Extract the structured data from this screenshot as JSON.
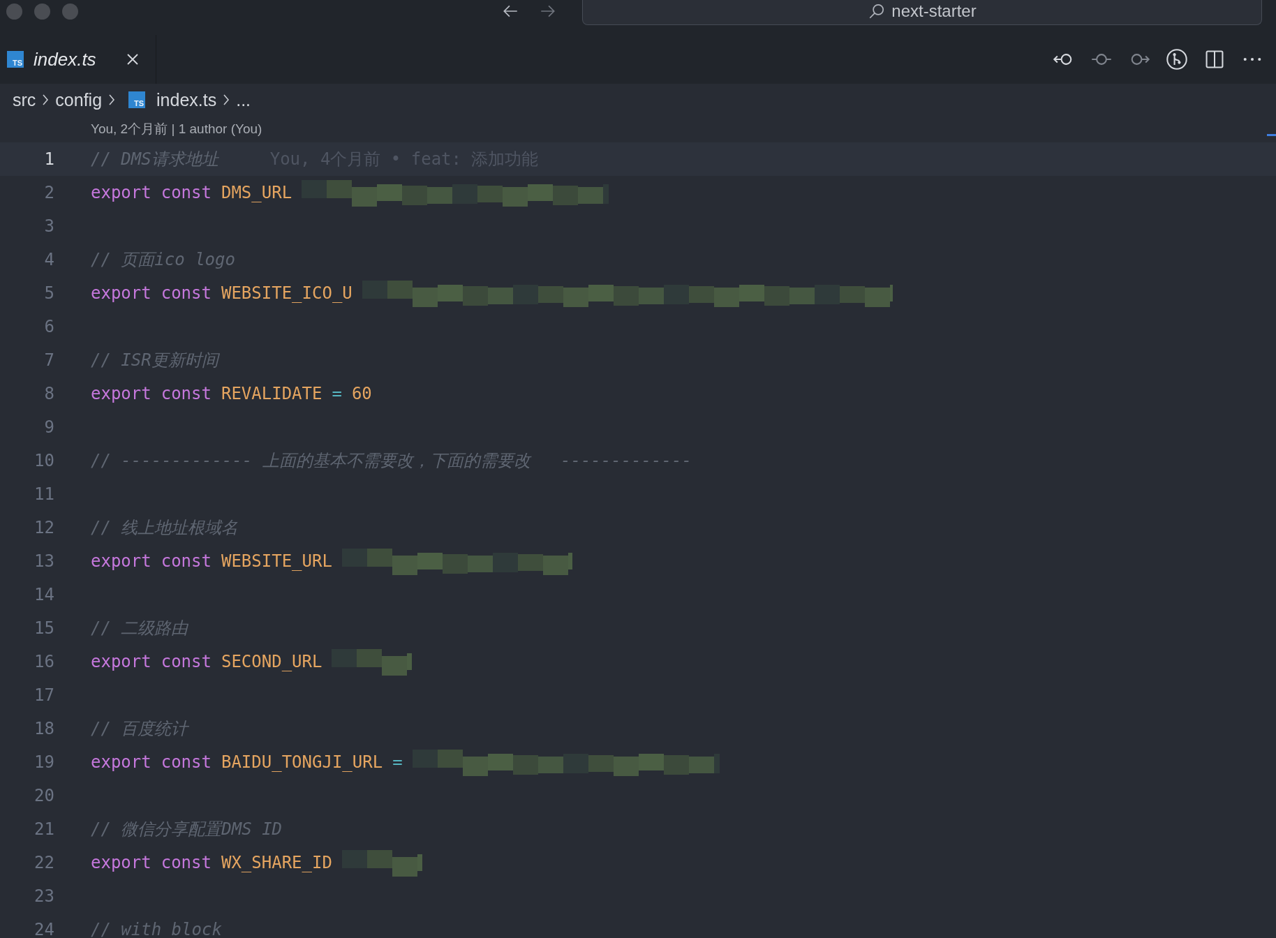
{
  "title_bar": {
    "search_label": "next-starter"
  },
  "tab": {
    "title": "index.ts",
    "file_badge": "TS",
    "selected": true,
    "preview": true
  },
  "breadcrumbs": [
    {
      "label": "src"
    },
    {
      "label": "config"
    },
    {
      "label": "index.ts",
      "file_badge": "TS"
    },
    {
      "label": "..."
    }
  ],
  "blame_header": "You, 2个月前 | 1 author (You)",
  "lines": [
    {
      "number": "1",
      "current": true,
      "tokens": [
        {
          "kind": "comment",
          "text": "// DMS请求地址"
        }
      ],
      "blame": "You, 4个月前 • feat: 添加功能"
    },
    {
      "number": "2",
      "current": false,
      "tokens": [
        {
          "kind": "keyword",
          "text": "export"
        },
        {
          "kind": "keyword",
          "text": "const"
        },
        {
          "kind": "constant",
          "text": "DMS_URL"
        }
      ],
      "redacted": true
    },
    {
      "number": "3",
      "current": false
    },
    {
      "number": "4",
      "current": false,
      "tokens": [
        {
          "kind": "comment",
          "text": "// 页面ico logo"
        }
      ]
    },
    {
      "number": "5",
      "current": false,
      "tokens": [
        {
          "kind": "keyword",
          "text": "export"
        },
        {
          "kind": "keyword",
          "text": "const"
        },
        {
          "kind": "constant",
          "text": "WEBSITE_ICO_U"
        }
      ],
      "redacted": true
    },
    {
      "number": "6",
      "current": false
    },
    {
      "number": "7",
      "current": false,
      "tokens": [
        {
          "kind": "comment",
          "text": "// ISR更新时间"
        }
      ]
    },
    {
      "number": "8",
      "current": false,
      "tokens": [
        {
          "kind": "keyword",
          "text": "export"
        },
        {
          "kind": "keyword",
          "text": "const"
        },
        {
          "kind": "constant",
          "text": "REVALIDATE"
        },
        {
          "kind": "operator",
          "text": "="
        },
        {
          "kind": "number",
          "text": "60"
        }
      ]
    },
    {
      "number": "9",
      "current": false
    },
    {
      "number": "10",
      "current": false,
      "tokens": [
        {
          "kind": "comment",
          "text": "// ------------- 上面的基本不需要改，下面的需要改   -------------"
        }
      ]
    },
    {
      "number": "11",
      "current": false
    },
    {
      "number": "12",
      "current": false,
      "tokens": [
        {
          "kind": "comment",
          "text": "// 线上地址根域名"
        }
      ]
    },
    {
      "number": "13",
      "current": false,
      "tokens": [
        {
          "kind": "keyword",
          "text": "export"
        },
        {
          "kind": "keyword",
          "text": "const"
        },
        {
          "kind": "constant",
          "text": "WEBSITE_URL"
        }
      ],
      "redacted": true
    },
    {
      "number": "14",
      "current": false
    },
    {
      "number": "15",
      "current": false,
      "tokens": [
        {
          "kind": "comment",
          "text": "// 二级路由"
        }
      ]
    },
    {
      "number": "16",
      "current": false,
      "tokens": [
        {
          "kind": "keyword",
          "text": "export"
        },
        {
          "kind": "keyword",
          "text": "const"
        },
        {
          "kind": "constant",
          "text": "SECOND_URL"
        }
      ],
      "redacted": true
    },
    {
      "number": "17",
      "current": false
    },
    {
      "number": "18",
      "current": false,
      "tokens": [
        {
          "kind": "comment",
          "text": "// 百度统计"
        }
      ]
    },
    {
      "number": "19",
      "current": false,
      "tokens": [
        {
          "kind": "keyword",
          "text": "export"
        },
        {
          "kind": "keyword",
          "text": "const"
        },
        {
          "kind": "constant",
          "text": "BAIDU_TONGJI_URL"
        },
        {
          "kind": "operator",
          "text": "="
        }
      ],
      "redacted": true
    },
    {
      "number": "20",
      "current": false
    },
    {
      "number": "21",
      "current": false,
      "tokens": [
        {
          "kind": "comment",
          "text": "// 微信分享配置DMS ID"
        }
      ]
    },
    {
      "number": "22",
      "current": false,
      "tokens": [
        {
          "kind": "keyword",
          "text": "export"
        },
        {
          "kind": "keyword",
          "text": "const"
        },
        {
          "kind": "constant",
          "text": "WX_SHARE_ID"
        }
      ],
      "redacted": true
    },
    {
      "number": "23",
      "current": false
    },
    {
      "number": "24",
      "current": false,
      "tokens": [
        {
          "kind": "comment",
          "text": "// with block"
        }
      ]
    }
  ]
}
